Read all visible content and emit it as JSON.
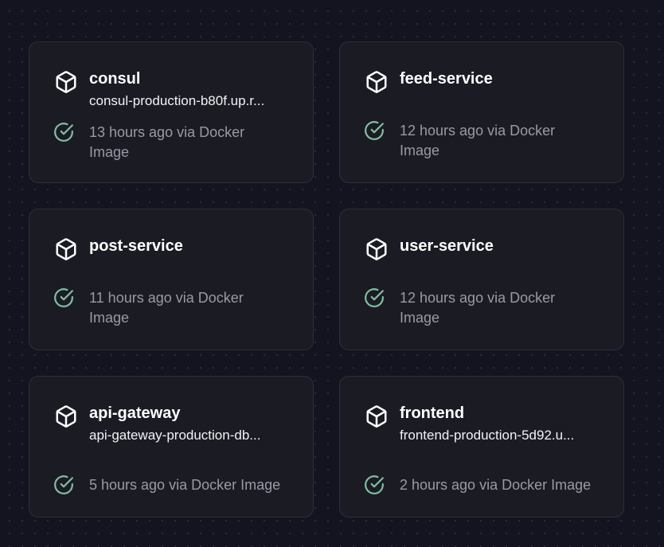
{
  "colors": {
    "background": "#141420",
    "card": "#1b1b24",
    "card_border": "#2e2e3a",
    "success": "#7fbf9f",
    "text": "#ffffff",
    "muted": "#9a9aa6"
  },
  "services": [
    {
      "name": "consul",
      "url": "consul-production-b80f.up.r...",
      "status": "13 hours ago via Docker Image",
      "icon": "box-icon",
      "status_icon": "check-circle-icon"
    },
    {
      "name": "feed-service",
      "url": "",
      "status": "12 hours ago via Docker Image",
      "icon": "box-icon",
      "status_icon": "check-circle-icon"
    },
    {
      "name": "post-service",
      "url": "",
      "status": "11 hours ago via Docker Image",
      "icon": "box-icon",
      "status_icon": "check-circle-icon"
    },
    {
      "name": "user-service",
      "url": "",
      "status": "12 hours ago via Docker Image",
      "icon": "box-icon",
      "status_icon": "check-circle-icon"
    },
    {
      "name": "api-gateway",
      "url": "api-gateway-production-db...",
      "status": "5 hours ago via Docker Image",
      "icon": "box-icon",
      "status_icon": "check-circle-icon"
    },
    {
      "name": "frontend",
      "url": "frontend-production-5d92.u...",
      "status": "2 hours ago via Docker Image",
      "icon": "box-icon",
      "status_icon": "check-circle-icon"
    }
  ]
}
